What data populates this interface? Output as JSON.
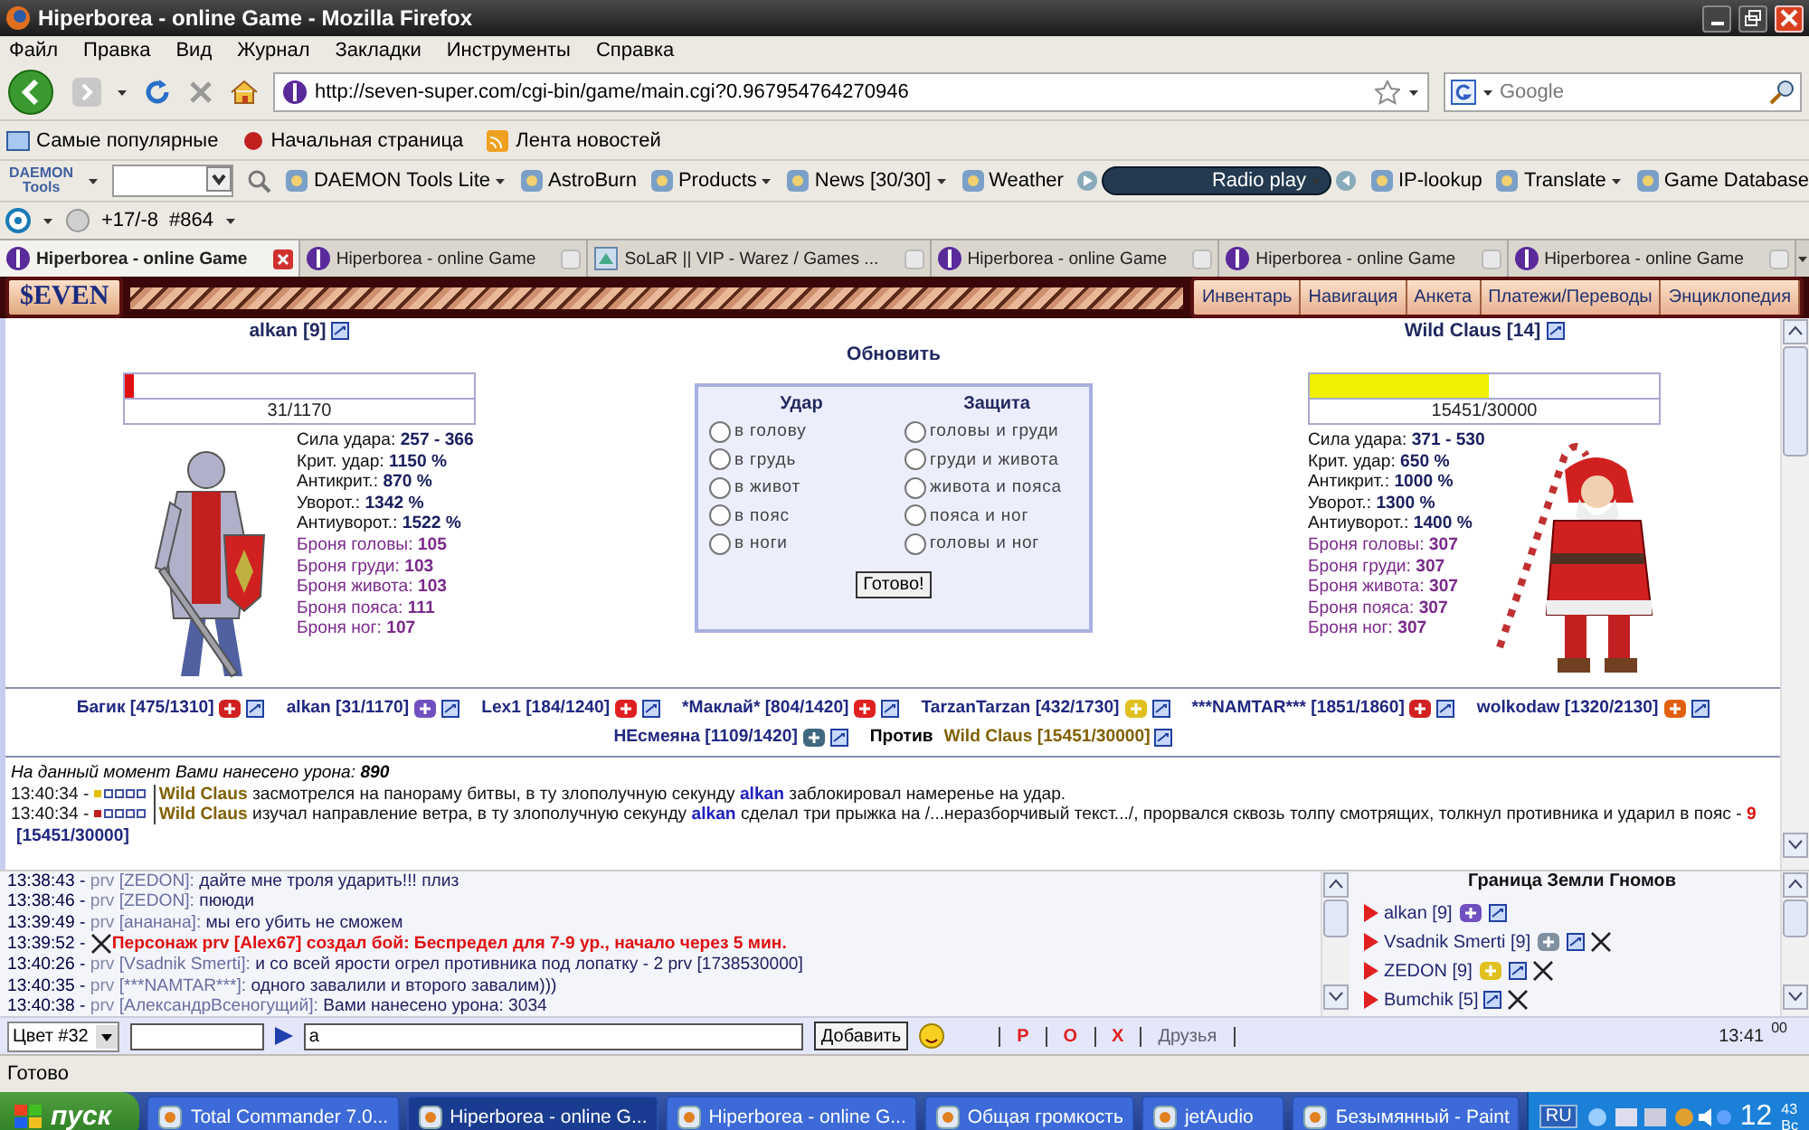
{
  "window": {
    "title": "Hiperborea - online Game - Mozilla Firefox"
  },
  "menu": [
    "Файл",
    "Правка",
    "Вид",
    "Журнал",
    "Закладки",
    "Инструменты",
    "Справка"
  ],
  "address": {
    "value": "http://seven-super.com/cgi-bin/game/main.cgi?0.967954764270946"
  },
  "search": {
    "placeholder": "Google"
  },
  "bookmarks": [
    "Самые популярные",
    "Начальная страница",
    "Лента новостей"
  ],
  "daemon_toolbar": {
    "logo_top": "DAEMON",
    "logo_bottom": "Tools",
    "items": [
      {
        "label": "DAEMON Tools Lite",
        "kind": "button",
        "dropdown": true
      },
      {
        "label": "AstroBurn",
        "kind": "button",
        "dropdown": false
      },
      {
        "label": "Products",
        "kind": "button",
        "dropdown": true
      },
      {
        "label": "News [30/30]",
        "kind": "button",
        "dropdown": true
      },
      {
        "label": "Weather",
        "kind": "button",
        "dropdown": false
      },
      {
        "label": "Radio play",
        "kind": "radio",
        "dropdown": true
      },
      {
        "label": "IP-lookup",
        "kind": "button",
        "dropdown": false
      },
      {
        "label": "Translate",
        "kind": "button",
        "dropdown": true
      },
      {
        "label": "Game Database",
        "kind": "button",
        "dropdown": false
      }
    ]
  },
  "mini_toolbar": [
    "+17/-8",
    "#864"
  ],
  "tabs": [
    {
      "title": "Hiperborea - online Game",
      "selected": true,
      "kind": "game"
    },
    {
      "title": "Hiperborea - online Game",
      "selected": false,
      "kind": "game"
    },
    {
      "title": "SoLaR || VIP - Warez / Games ...",
      "selected": false,
      "kind": "forum"
    },
    {
      "title": "Hiperborea - online Game",
      "selected": false,
      "kind": "game"
    },
    {
      "title": "Hiperborea - online Game",
      "selected": false,
      "kind": "game"
    },
    {
      "title": "Hiperborea - online Game",
      "selected": false,
      "kind": "game"
    }
  ],
  "game_menu": {
    "logo": "$EVEN",
    "items": [
      "Инвентарь",
      "Навигация",
      "Анкета",
      "Платежи/Переводы",
      "Энциклопедия"
    ]
  },
  "fighters": [
    {
      "name": "alkan [9]",
      "hp": "31/1170",
      "level": 0.026,
      "color": "#e01010",
      "stats": [
        {
          "label": "Сила удара:",
          "value": "257 - 366",
          "kind": "attack"
        },
        {
          "label": "Крит. удар:",
          "value": "1150 %",
          "kind": "attack"
        },
        {
          "label": "Антикрит.:",
          "value": "870 %",
          "kind": "attack"
        },
        {
          "label": "Уворот.:",
          "value": "1342 %",
          "kind": "attack"
        },
        {
          "label": "Антиуворот.:",
          "value": "1522 %",
          "kind": "attack"
        },
        {
          "label": "Броня головы:",
          "value": "105",
          "kind": "armor"
        },
        {
          "label": "Броня груди:",
          "value": "103",
          "kind": "armor"
        },
        {
          "label": "Броня живота:",
          "value": "103",
          "kind": "armor"
        },
        {
          "label": "Броня пояса:",
          "value": "111",
          "kind": "armor"
        },
        {
          "label": "Броня ног:",
          "value": "107",
          "kind": "armor"
        }
      ]
    },
    {
      "name": "Wild Claus [14]",
      "hp": "15451/30000",
      "level": 0.515,
      "color": "#f0f000",
      "stats": [
        {
          "label": "Сила удара:",
          "value": "371 - 530",
          "kind": "attack"
        },
        {
          "label": "Крит. удар:",
          "value": "650 %",
          "kind": "attack"
        },
        {
          "label": "Антикрит.:",
          "value": "1000 %",
          "kind": "attack"
        },
        {
          "label": "Уворот.:",
          "value": "1300 %",
          "kind": "attack"
        },
        {
          "label": "Антиуворот.:",
          "value": "1400 %",
          "kind": "attack"
        },
        {
          "label": "Броня головы:",
          "value": "307",
          "kind": "armor"
        },
        {
          "label": "Броня груди:",
          "value": "307",
          "kind": "armor"
        },
        {
          "label": "Броня живота:",
          "value": "307",
          "kind": "armor"
        },
        {
          "label": "Броня пояса:",
          "value": "307",
          "kind": "armor"
        },
        {
          "label": "Броня ног:",
          "value": "307",
          "kind": "armor"
        }
      ]
    }
  ],
  "refresh": "Обновить",
  "attack": {
    "title": "Удар",
    "options": [
      {
        "label": "в голову",
        "selected": false
      },
      {
        "label": "в грудь",
        "selected": false
      },
      {
        "label": "в живот",
        "selected": false
      },
      {
        "label": "в пояс",
        "selected": false
      },
      {
        "label": "в ноги",
        "selected": false
      }
    ]
  },
  "defense": {
    "title": "Защита",
    "options": [
      {
        "label": "головы и груди",
        "selected": false
      },
      {
        "label": "груди и живота",
        "selected": false
      },
      {
        "label": "живота и пояса",
        "selected": false
      },
      {
        "label": "пояса и ног",
        "selected": false
      },
      {
        "label": "головы и ног",
        "selected": false
      }
    ]
  },
  "submit": "Готово!",
  "participants": [
    {
      "name": "Багик [475/1310]",
      "color": "#d02020"
    },
    {
      "name": "alkan [31/1170]",
      "color": "#7050c0"
    },
    {
      "name": "Lex1 [184/1240]",
      "color": "#e02020"
    },
    {
      "name": "*Маклай* [804/1420]",
      "color": "#e02020"
    },
    {
      "name": "TarzanTarzan [432/1730]",
      "color": "#e0c020"
    },
    {
      "name": "***NAMTAR*** [1851/1860]",
      "color": "#d02020"
    },
    {
      "name": "wolkodaw [1320/2130]",
      "color": "#e06010"
    },
    {
      "name": "НЕсмеяна [1109/1420]",
      "color": "#406880"
    }
  ],
  "versus": {
    "label": "Против",
    "name": "Wild Claus [15451/30000]"
  },
  "damage_summary": "На данный момент Вами нанесено урона: **890**",
  "log": [
    {
      "time": "13:40:34 -",
      "color": "#e0c000",
      "actor": "Wild Claus",
      "text": "засмотрелся на панораму битвы, в ту злополучную секунду **alkan** заблокировал намеренье на удар."
    },
    {
      "time": "13:40:34 -",
      "color": "#c02020",
      "actor": "Wild Claus",
      "text": "изучал направление ветра, в ту злополучную секунду **alkan** сделал три прыжка на /...неразборчивый текст.../, прорвался сквозь толпу смотрящих, толкнул противника и ударил в пояс -",
      "damage": "9",
      "hp": "[15451/30000]"
    }
  ],
  "chat": [
    {
      "time": "13:38:43 -",
      "kind": "message",
      "prefix": "prv",
      "sender": "[ZEDON]:",
      "text": "дайте мне троля ударить!!! плиз"
    },
    {
      "time": "13:38:46 -",
      "kind": "message",
      "prefix": "prv",
      "sender": "[ZEDON]:",
      "text": "пююди"
    },
    {
      "time": "13:39:49 -",
      "kind": "message",
      "prefix": "prv",
      "sender": "[ананана]:",
      "text": "мы его убить не сможем"
    },
    {
      "time": "13:39:52 -",
      "kind": "system",
      "text": "Персонаж prv [Alex67] создал бой: Беспредел для 7-9 ур., начало через 5 мин."
    },
    {
      "time": "13:40:26 -",
      "kind": "message",
      "prefix": "prv",
      "sender": "[Vsadnik Smerti]:",
      "text": "и со всей ярости огрел противника под лопатку - 2 prv [1738530000]"
    },
    {
      "time": "13:40:35 -",
      "kind": "message",
      "prefix": "prv",
      "sender": "[***NAMTAR***]:",
      "text": "одного завалили и второго завалим)))"
    },
    {
      "time": "13:40:38 -",
      "kind": "message",
      "prefix": "prv",
      "sender": "[АлександрВсеногущий]:",
      "text": "Вами нанесено урона: 3034"
    }
  ],
  "location": {
    "title": "Граница Земли Гномов",
    "players": [
      {
        "name": "alkan [9]",
        "color": "#7050c0",
        "fighting": false
      },
      {
        "name": "Vsadnik Smerti [9]",
        "color": "#8090a0",
        "fighting": true
      },
      {
        "name": "ZEDON [9]",
        "color": "#e0c020",
        "fighting": true
      },
      {
        "name": "Bumchik [5]",
        "fighting": true
      }
    ]
  },
  "input_bar": {
    "color_select": "Цвет #32",
    "message": "a",
    "send": "Добавить",
    "links": [
      {
        "label": "P",
        "color": "#e02020"
      },
      {
        "label": "O",
        "color": "#e02020"
      },
      {
        "label": "X",
        "color": "#e02020"
      },
      {
        "label": "Друзья",
        "color": "#606070"
      }
    ],
    "time": "13:41",
    "seconds": "00"
  },
  "status_bar": "Готово",
  "taskbar": {
    "start": "пуск",
    "tasks": [
      {
        "title": "Total Commander 7.0...",
        "selected": false
      },
      {
        "title": "Hiperborea - online G...",
        "selected": true
      },
      {
        "title": "Hiperborea - online G...",
        "selected": false
      },
      {
        "title": "Общая громкость",
        "selected": false
      },
      {
        "title": "jetAudio",
        "selected": false
      },
      {
        "title": "Безымянный - Paint",
        "selected": false
      }
    ],
    "language": "RU",
    "hour": "12",
    "minute": "43",
    "day": "Вс"
  }
}
